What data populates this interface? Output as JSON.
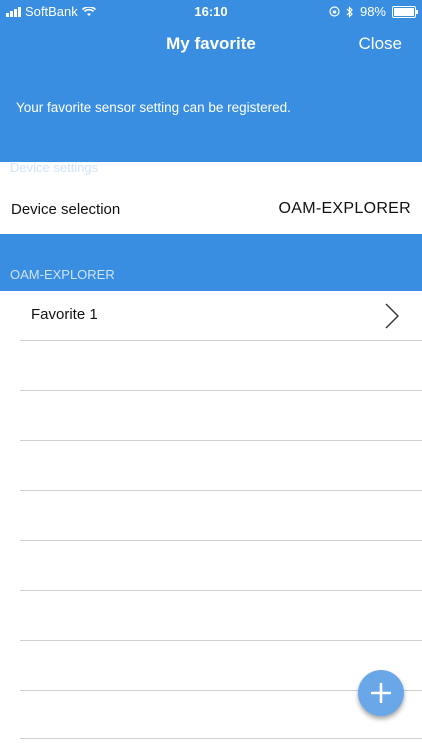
{
  "status": {
    "carrier": "SoftBank",
    "time": "16:10",
    "battery": "98%",
    "battery_level": 0.98
  },
  "header": {
    "title": "My favorite",
    "close_label": "Close",
    "description": "Your favorite sensor setting can be registered."
  },
  "device_settings": {
    "section_label": "Device settings",
    "row_label": "Device selection",
    "row_value": "OAM-EXPLORER"
  },
  "favorites": {
    "section_label": "OAM-EXPLORER",
    "items": [
      {
        "label": "Favorite 1"
      },
      {
        "label": ""
      },
      {
        "label": ""
      },
      {
        "label": ""
      },
      {
        "label": ""
      },
      {
        "label": ""
      },
      {
        "label": ""
      },
      {
        "label": ""
      },
      {
        "label": ""
      }
    ]
  },
  "fab": {
    "icon": "plus-icon"
  },
  "colors": {
    "primary": "#3a8ee2",
    "fab": "#6aa7e9"
  }
}
